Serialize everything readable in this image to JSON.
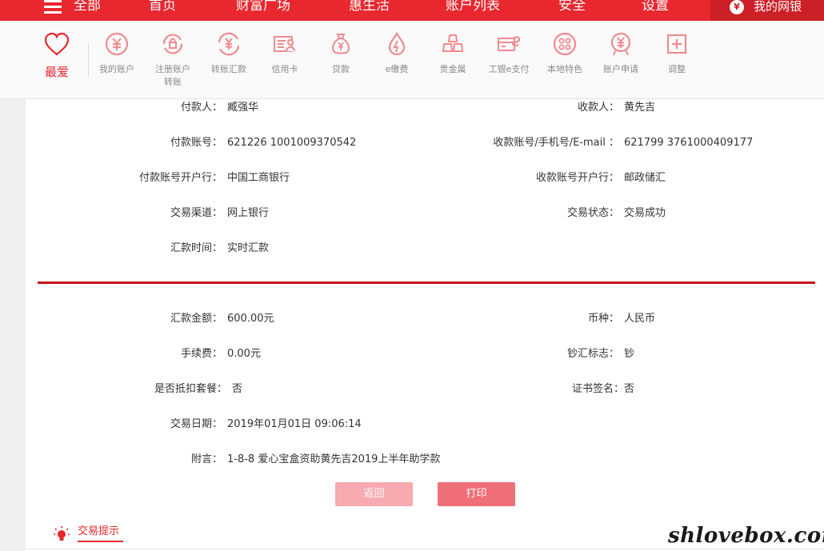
{
  "topnav": {
    "items": [
      "全部",
      "首页",
      "财富广场",
      "惠生活",
      "账户列表",
      "安全",
      "设置"
    ],
    "my_wangyin": "我的网银"
  },
  "quickbar": {
    "items": [
      {
        "label": "最爱",
        "icon": "heart-icon"
      },
      {
        "label": "我的账户",
        "icon": "yuan-circle-icon"
      },
      {
        "label": "注册账户转账",
        "icon": "lock-transfer-icon"
      },
      {
        "label": "转账汇款",
        "icon": "exchange-yuan-icon"
      },
      {
        "label": "信用卡",
        "icon": "card-user-icon"
      },
      {
        "label": "贷款",
        "icon": "money-bag-icon"
      },
      {
        "label": "e缴费",
        "icon": "drop-bolt-icon"
      },
      {
        "label": "贵金属",
        "icon": "gold-bars-icon"
      },
      {
        "label": "工银e支付",
        "icon": "card-e-icon"
      },
      {
        "label": "本地特色",
        "icon": "dots-circle-icon"
      },
      {
        "label": "账户申请",
        "icon": "yuan-tag-icon"
      },
      {
        "label": "调整",
        "icon": "plus-square-icon"
      }
    ]
  },
  "payer": {
    "label": "付款人：",
    "value": "臧强华"
  },
  "payee": {
    "label": "收款人：",
    "value": "黄先吉"
  },
  "payer_account": {
    "label": "付款账号：",
    "value": "621226 1001009370542"
  },
  "payee_account": {
    "label": "收款账号/手机号/E-mail ：",
    "value": "621799 3761000409177"
  },
  "payer_bank": {
    "label": "付款账号开户行：",
    "value": "中国工商银行"
  },
  "payee_bank": {
    "label": "收款账号开户行：",
    "value": "邮政储汇"
  },
  "channel": {
    "label": "交易渠道：",
    "value": "网上银行"
  },
  "status": {
    "label": "交易状态：",
    "value": "交易成功"
  },
  "remit_time": {
    "label": "汇款时间：",
    "value": "实时汇款"
  },
  "amount": {
    "label": "汇款金额：",
    "value": "600.00元"
  },
  "currency": {
    "label": "币种：",
    "value": "人民币"
  },
  "fee": {
    "label": "手续费：",
    "value": "0.00元"
  },
  "cash_flag": {
    "label": "钞汇标志：",
    "value": "钞"
  },
  "package_deduct": {
    "label": "是否抵扣套餐：",
    "value": "否"
  },
  "cert_sign": {
    "label": "证书签名：",
    "value": "否"
  },
  "trade_date": {
    "label": "交易日期：",
    "value": "2019年01月01日 09:06:14"
  },
  "remark": {
    "label": "附言：",
    "value": "1-8-8 爱心宝盒资助黄先吉2019上半年助学款"
  },
  "buttons": {
    "back": "返回",
    "print": "打印"
  },
  "tips": {
    "label": "交易提示"
  },
  "watermark": "shlovebox.com",
  "colors": {
    "brand_red": "#e8272f",
    "divider_red": "#c6141c",
    "btn_back": "#f7aab0",
    "btn_print": "#ef6f78"
  }
}
